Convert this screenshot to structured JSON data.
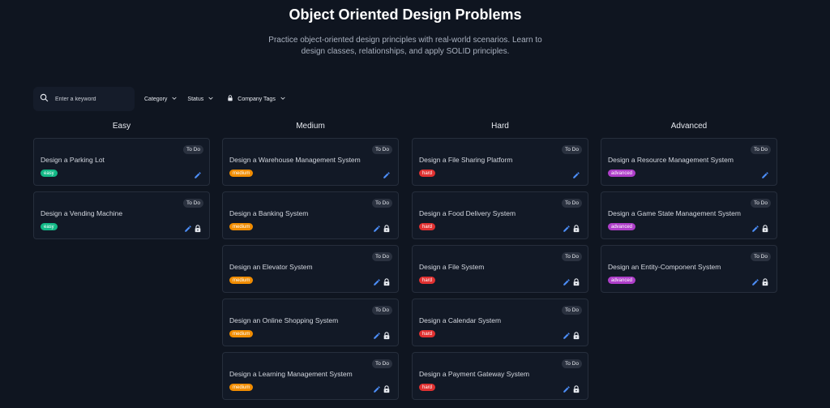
{
  "header": {
    "title": "Object Oriented Design Problems",
    "subtitle": "Practice object-oriented design principles with real-world scenarios. Learn to design classes, relationships, and apply SOLID principles."
  },
  "toolbar": {
    "search_placeholder": "Enter a keyword",
    "category_label": "Category",
    "status_label": "Status",
    "company_tags_label": "Company Tags"
  },
  "colors": {
    "easy": "#12b886",
    "medium": "#f08c00",
    "hard": "#e03131",
    "advanced": "#ae3ec9",
    "edit_icon": "#4c8df6"
  },
  "columns": [
    {
      "heading": "Easy",
      "items": [
        {
          "name": "Design a Parking Lot",
          "status": "To Do",
          "badge": "easy",
          "locked": false
        },
        {
          "name": "Design a Vending Machine",
          "status": "To Do",
          "badge": "easy",
          "locked": true
        }
      ]
    },
    {
      "heading": "Medium",
      "items": [
        {
          "name": "Design a Warehouse Management System",
          "status": "To Do",
          "badge": "medium",
          "locked": false
        },
        {
          "name": "Design a Banking System",
          "status": "To Do",
          "badge": "medium",
          "locked": true
        },
        {
          "name": "Design an Elevator System",
          "status": "To Do",
          "badge": "medium",
          "locked": true
        },
        {
          "name": "Design an Online Shopping System",
          "status": "To Do",
          "badge": "medium",
          "locked": true
        },
        {
          "name": "Design a Learning Management System",
          "status": "To Do",
          "badge": "medium",
          "locked": true
        }
      ]
    },
    {
      "heading": "Hard",
      "items": [
        {
          "name": "Design a File Sharing Platform",
          "status": "To Do",
          "badge": "hard",
          "locked": false
        },
        {
          "name": "Design a Food Delivery System",
          "status": "To Do",
          "badge": "hard",
          "locked": true
        },
        {
          "name": "Design a File System",
          "status": "To Do",
          "badge": "hard",
          "locked": true
        },
        {
          "name": "Design a Calendar System",
          "status": "To Do",
          "badge": "hard",
          "locked": true
        },
        {
          "name": "Design a Payment Gateway System",
          "status": "To Do",
          "badge": "hard",
          "locked": true
        }
      ]
    },
    {
      "heading": "Advanced",
      "items": [
        {
          "name": "Design a Resource Management System",
          "status": "To Do",
          "badge": "advanced",
          "locked": false
        },
        {
          "name": "Design a Game State Management System",
          "status": "To Do",
          "badge": "advanced",
          "locked": true
        },
        {
          "name": "Design an Entity-Component System",
          "status": "To Do",
          "badge": "advanced",
          "locked": true
        }
      ]
    }
  ]
}
